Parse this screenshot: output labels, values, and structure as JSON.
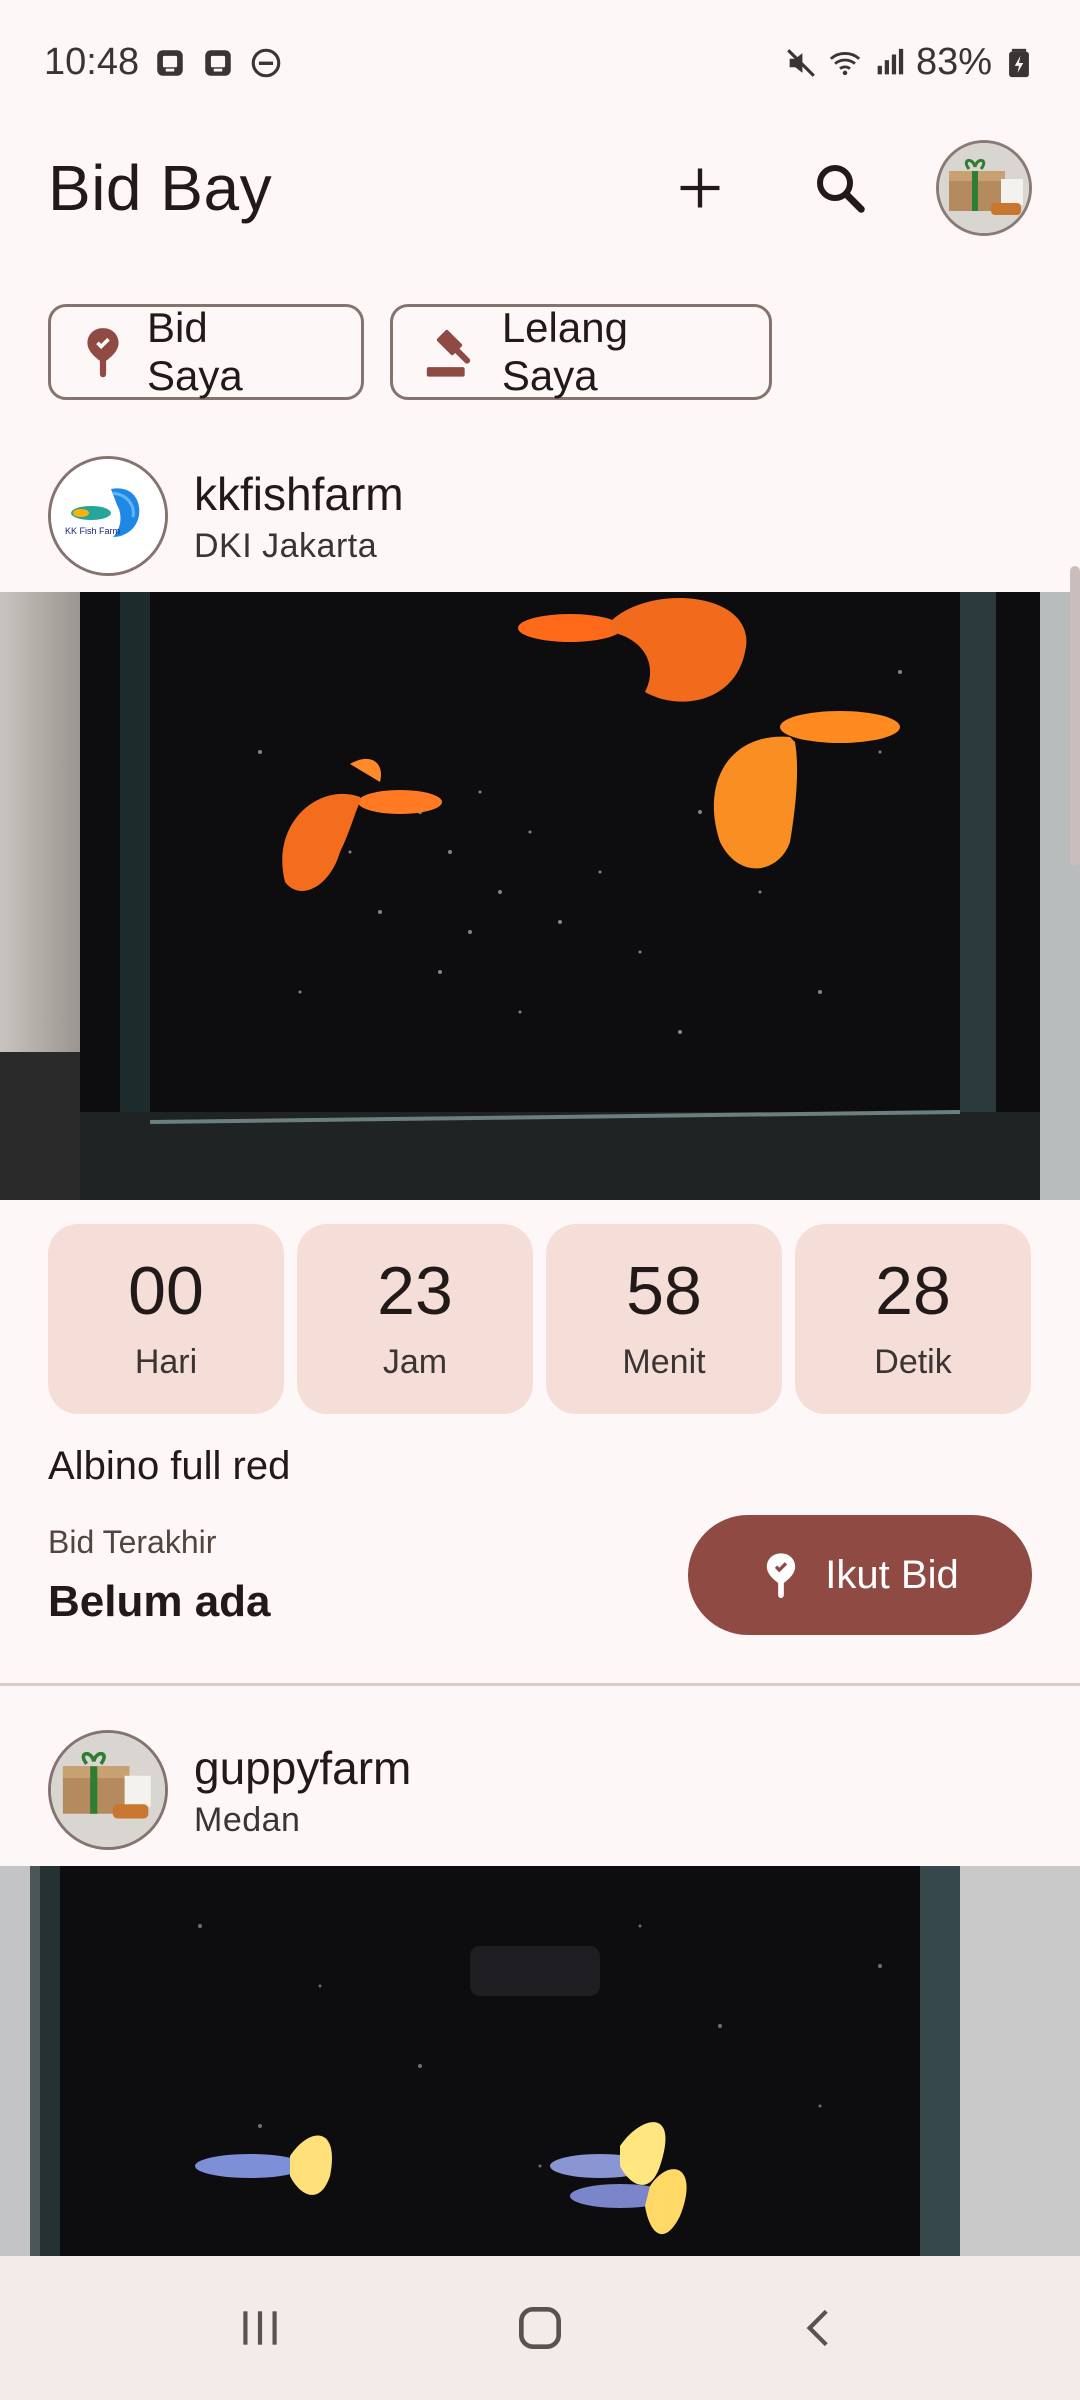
{
  "status_bar": {
    "time": "10:48",
    "battery": "83%",
    "icons": [
      "notification-app-icon",
      "notification-app-icon",
      "do-not-disturb-icon",
      "mute-icon",
      "wifi-icon",
      "signal-icon",
      "battery-charging-icon"
    ]
  },
  "app_bar": {
    "title": "Bid Bay",
    "actions": [
      "add-icon",
      "search-icon",
      "profile-avatar"
    ]
  },
  "chips": [
    {
      "label": "Bid Saya",
      "icon": "bid-pin-icon"
    },
    {
      "label": "Lelang Saya",
      "icon": "gavel-icon"
    }
  ],
  "posts": [
    {
      "username": "kkfishfarm",
      "location": "DKI Jakarta",
      "avatar_text": "KK Fish Farm",
      "countdown": [
        {
          "value": "00",
          "label": "Hari"
        },
        {
          "value": "23",
          "label": "Jam"
        },
        {
          "value": "58",
          "label": "Menit"
        },
        {
          "value": "28",
          "label": "Detik"
        }
      ],
      "title": "Albino full red",
      "last_bid_label": "Bid Terakhir",
      "last_bid_value": "Belum ada",
      "bid_button": "Ikut Bid"
    },
    {
      "username": "guppyfarm",
      "location": "Medan"
    }
  ],
  "colors": {
    "background": "#fdf8f7",
    "accent": "#8f4a43",
    "countdown_bg": "#f5ddd8",
    "outline": "#857370"
  },
  "nav_bar": [
    "recent-apps-icon",
    "home-icon",
    "back-icon"
  ]
}
